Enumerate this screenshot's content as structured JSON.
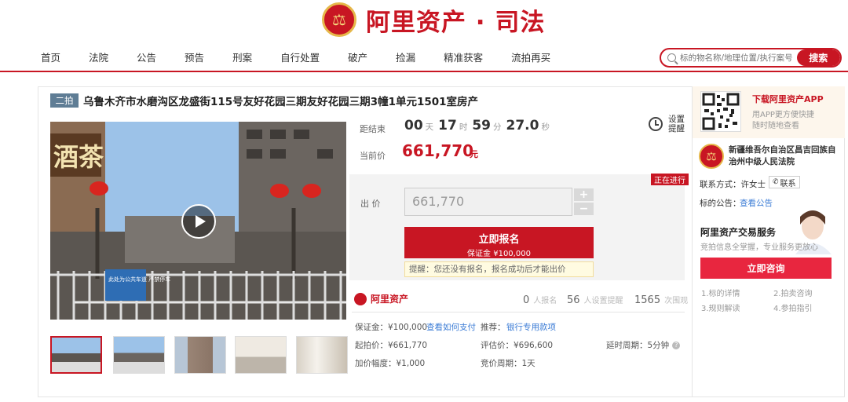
{
  "header": {
    "logo_char": "⚖",
    "brand": "阿里资产 · 司法",
    "nav": [
      "首页",
      "法院",
      "公告",
      "预告",
      "刑案",
      "自行处置",
      "破产",
      "捡漏",
      "精准获客",
      "流拍再买"
    ],
    "search_placeholder": "标的物名称/地理位置/执行案号",
    "search_button": "搜索"
  },
  "item": {
    "round_badge": "二拍",
    "title": "乌鲁木齐市水磨沟区龙盛街115号友好花园三期友好花园三期3幢1单元1501室房产",
    "photo_sign_top": "酒茶",
    "photo_sign_bottom": "此处为公共车道 严禁停车"
  },
  "auction": {
    "countdown_label": "距结束",
    "countdown": {
      "days": "00",
      "days_unit": "天",
      "hours": "17",
      "hours_unit": "时",
      "minutes": "59",
      "minutes_unit": "分",
      "seconds": "27.0",
      "seconds_unit": "秒"
    },
    "remind_label": "设置",
    "remind_label2": "提醒",
    "current_price_label": "当前价",
    "current_price": "661,770",
    "current_price_unit": "元",
    "status_badge": "正在进行",
    "bid_label": "出  价",
    "bid_value": "661,770",
    "plus": "+",
    "minus": "−",
    "signup_button": "立即报名",
    "deposit_line": "保证金 ¥100,000",
    "tip": "提醒：您还没有报名，报名成功后才能出价"
  },
  "stats": {
    "logo_text": "阿里资产",
    "signups": "0",
    "signups_label": "人报名",
    "reminders": "56",
    "reminders_label": "人设置提醒",
    "views": "1565",
    "views_label": "次围观"
  },
  "details": {
    "deposit_label": "保证金：¥100,000",
    "how_to_pay": "查看如何支付",
    "recommend_label": "推荐：",
    "bank_loan": "银行专用款项",
    "start_price": "起拍价：¥661,770",
    "appraisal": "评估价：¥696,600",
    "delay": "延时周期：5分钟",
    "increment": "加价幅度：¥1,000",
    "cycle": "竞价周期：1天"
  },
  "sidebar": {
    "download_title": "下载阿里资产APP",
    "download_sub1": "用APP更方便快捷",
    "download_sub2": "随时随地查看",
    "court_name_1": "新疆维吾尔自治区昌吉回族自",
    "court_name_2": "治州中级人民法院",
    "contact_label": "联系方式：许女士",
    "contact_button": "联系",
    "notice_label": "标的公告：",
    "notice_link": "查看公告",
    "service_title": "阿里资产交易服务",
    "service_sub": "竞拍信息全掌握，专业服务更放心",
    "consult_button": "立即咨询",
    "links": [
      "1.标的详情",
      "2.拍卖咨询",
      "3.规则解读",
      "4.参拍指引"
    ]
  },
  "colors": {
    "accent": "#c81623",
    "link": "#3a7bd5",
    "badge": "#5f7d95"
  }
}
